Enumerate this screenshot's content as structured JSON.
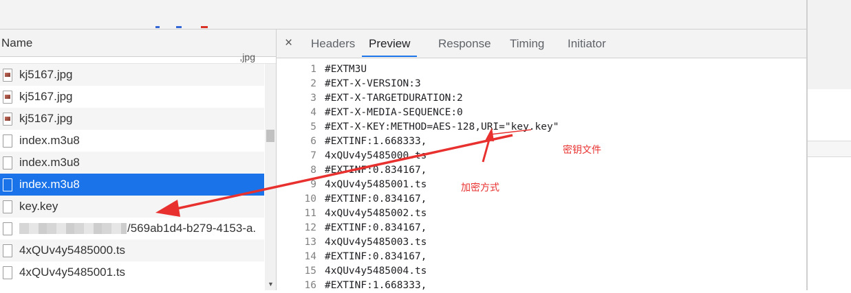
{
  "request_list": {
    "header": "Name",
    "rows": [
      {
        "name": "kj5167.jpg",
        "type": "image"
      },
      {
        "name": "kj5167.jpg",
        "type": "image"
      },
      {
        "name": "kj5167.jpg",
        "type": "image"
      },
      {
        "name": "index.m3u8",
        "type": "file"
      },
      {
        "name": "index.m3u8",
        "type": "file"
      },
      {
        "name": "index.m3u8",
        "type": "file",
        "selected": true
      },
      {
        "name": "key.key",
        "type": "file"
      },
      {
        "name": "/569ab1d4-b279-4153-a.",
        "type": "file",
        "blurred_prefix": true
      },
      {
        "name": "4xQUv4y5485000.ts",
        "type": "file"
      },
      {
        "name": "4xQUv4y5485001.ts",
        "type": "file"
      }
    ]
  },
  "preview_panel": {
    "close_glyph": "×",
    "tabs": [
      "Headers",
      "Preview",
      "Response",
      "Timing",
      "Initiator"
    ],
    "active_tab": "Preview",
    "lines": [
      "#EXTM3U",
      "#EXT-X-VERSION:3",
      "#EXT-X-TARGETDURATION:2",
      "#EXT-X-MEDIA-SEQUENCE:0",
      "#EXT-X-KEY:METHOD=AES-128,URI=\"key.key\"",
      "#EXTINF:1.668333,",
      "4xQUv4y5485000.ts",
      "#EXTINF:0.834167,",
      "4xQUv4y5485001.ts",
      "#EXTINF:0.834167,",
      "4xQUv4y5485002.ts",
      "#EXTINF:0.834167,",
      "4xQUv4y5485003.ts",
      "#EXTINF:0.834167,",
      "4xQUv4y5485004.ts",
      "#EXTINF:1.668333,"
    ]
  },
  "annotations": {
    "key_file": "密钥文件",
    "encryption_method": "加密方式",
    "color": "#e8312f"
  },
  "colors": {
    "selected_row": "#1a73e8",
    "active_tab_underline": "#1a73e8"
  }
}
